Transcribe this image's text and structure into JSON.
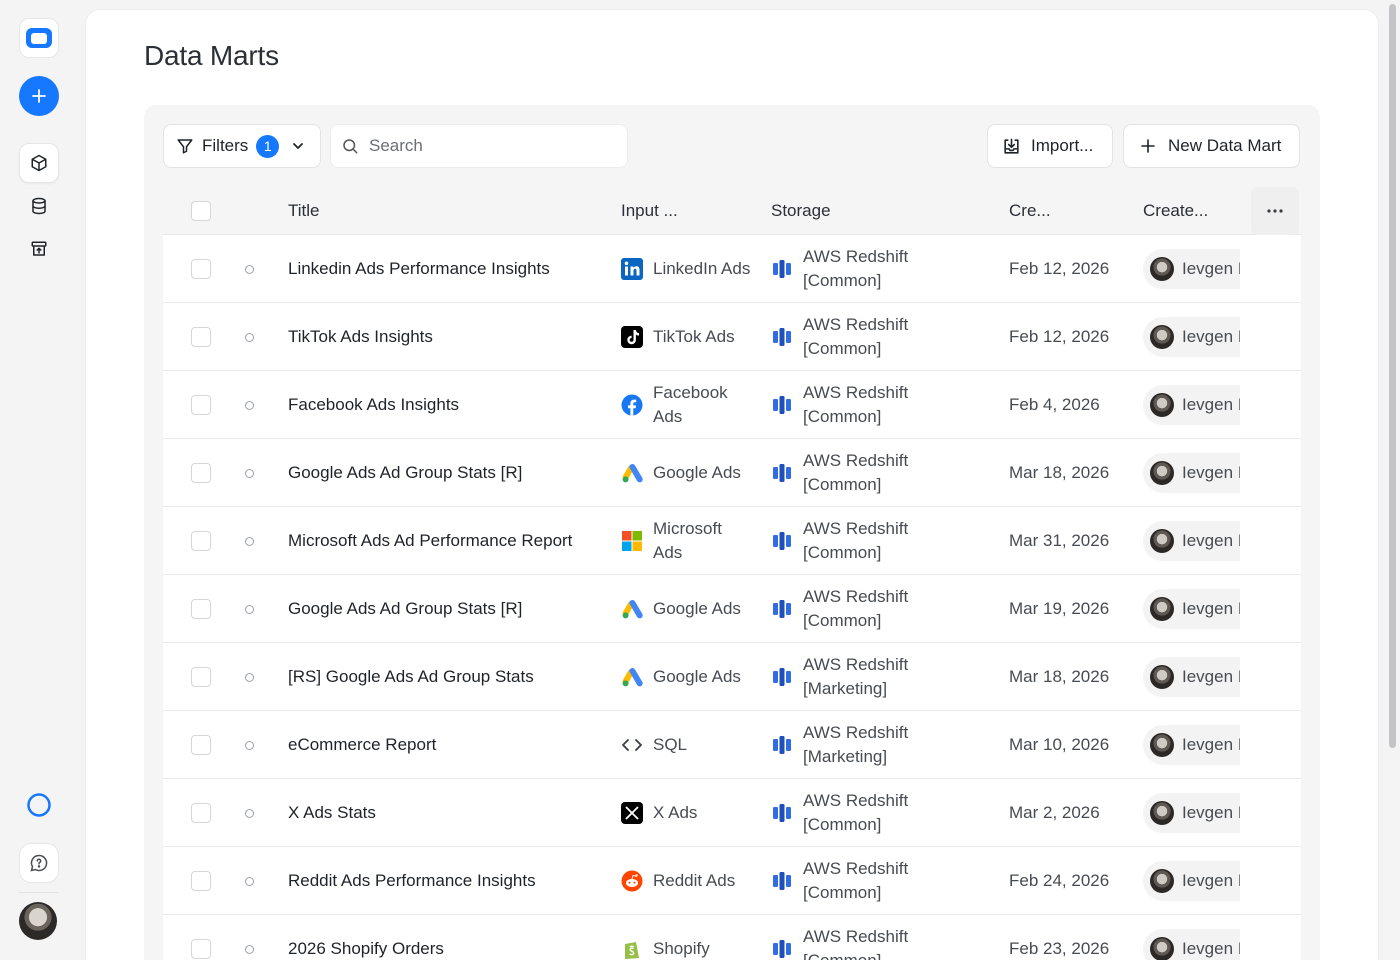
{
  "page": {
    "title": "Data Marts"
  },
  "toolbar": {
    "filters_label": "Filters",
    "filters_count": "1",
    "search_placeholder": "Search",
    "import_label": "Import...",
    "new_label": "New Data Mart"
  },
  "table": {
    "headers": {
      "title": "Title",
      "input": "Input ...",
      "storage": "Storage",
      "created": "Cre...",
      "creator": "Create..."
    },
    "rows": [
      {
        "title": "Linkedin Ads Performance Insights",
        "source": "LinkedIn Ads",
        "source_icon": "linkedin-icon",
        "storage": "AWS Redshift [Common]",
        "created": "Feb 12, 2026",
        "owner": "Ievgen I"
      },
      {
        "title": "TikTok Ads Insights",
        "source": "TikTok Ads",
        "source_icon": "tiktok-icon",
        "storage": "AWS Redshift [Common]",
        "created": "Feb 12, 2026",
        "owner": "Ievgen I"
      },
      {
        "title": "Facebook Ads Insights",
        "source": "Facebook Ads",
        "source_icon": "facebook-icon",
        "storage": "AWS Redshift [Common]",
        "created": "Feb 4, 2026",
        "owner": "Ievgen I"
      },
      {
        "title": "Google Ads Ad Group Stats [R]",
        "source": "Google Ads",
        "source_icon": "google-ads-icon",
        "storage": "AWS Redshift [Common]",
        "created": "Mar 18, 2026",
        "owner": "Ievgen I"
      },
      {
        "title": "Microsoft Ads Ad Performance Report",
        "source": "Microsoft Ads",
        "source_icon": "microsoft-icon",
        "storage": "AWS Redshift [Common]",
        "created": "Mar 31, 2026",
        "owner": "Ievgen I"
      },
      {
        "title": "Google Ads Ad Group Stats [R]",
        "source": "Google Ads",
        "source_icon": "google-ads-icon",
        "storage": "AWS Redshift [Common]",
        "created": "Mar 19, 2026",
        "owner": "Ievgen I"
      },
      {
        "title": "[RS] Google Ads Ad Group Stats",
        "source": "Google Ads",
        "source_icon": "google-ads-icon",
        "storage": "AWS Redshift [Marketing]",
        "created": "Mar 18, 2026",
        "owner": "Ievgen I"
      },
      {
        "title": "eCommerce Report",
        "source": "SQL",
        "source_icon": "code-icon",
        "storage": "AWS Redshift [Marketing]",
        "created": "Mar 10, 2026",
        "owner": "Ievgen I"
      },
      {
        "title": "X Ads Stats",
        "source": "X Ads",
        "source_icon": "x-icon",
        "storage": "AWS Redshift [Common]",
        "created": "Mar 2, 2026",
        "owner": "Ievgen I"
      },
      {
        "title": "Reddit Ads Performance Insights",
        "source": "Reddit Ads",
        "source_icon": "reddit-icon",
        "storage": "AWS Redshift [Common]",
        "created": "Feb 24, 2026",
        "owner": "Ievgen I"
      },
      {
        "title": "2026 Shopify Orders",
        "source": "Shopify",
        "source_icon": "shopify-icon",
        "storage": "AWS Redshift [Common]",
        "created": "Feb 23, 2026",
        "owner": "Ievgen I"
      }
    ]
  },
  "colors": {
    "accent": "#1677ff",
    "redshift": "#2a5bd7"
  }
}
